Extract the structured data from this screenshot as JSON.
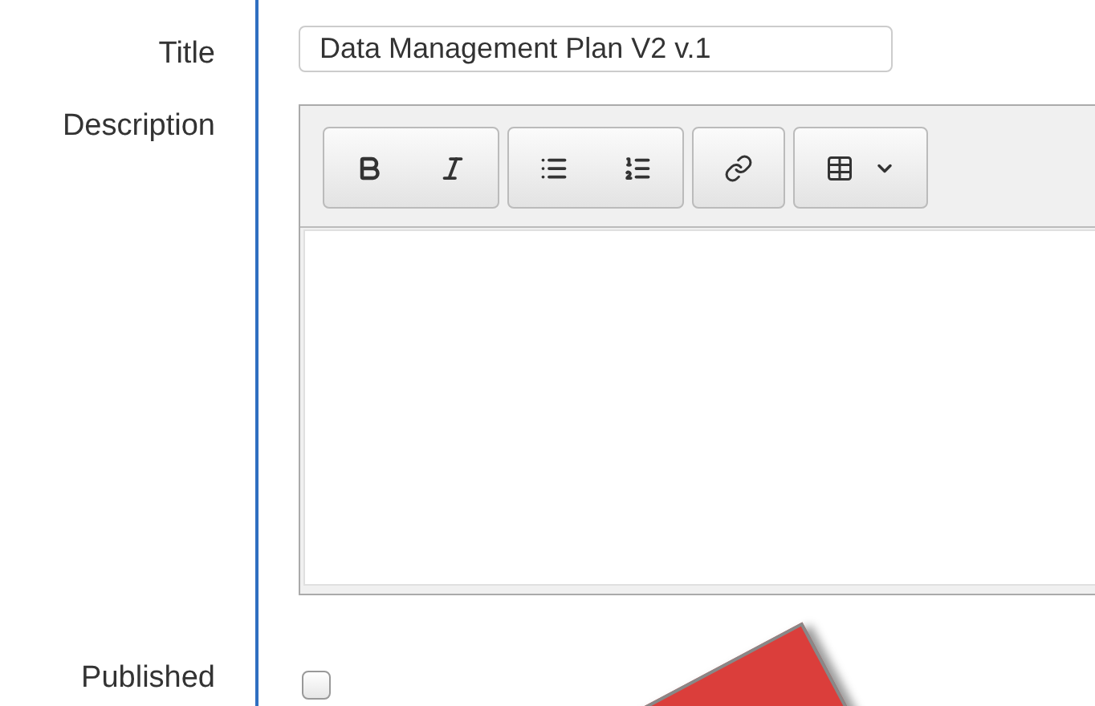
{
  "fields": [
    {
      "kind": "text",
      "label": "Title",
      "value": "Data Management Plan V2 v.1"
    },
    {
      "kind": "editor",
      "label": "Description"
    },
    {
      "kind": "checkbox",
      "label": "Published",
      "checked": false
    }
  ],
  "toolbar": [
    [
      {
        "kind": "bold"
      },
      {
        "kind": "italic"
      }
    ],
    [
      {
        "kind": "bullets"
      },
      {
        "kind": "numbers"
      }
    ],
    [
      {
        "kind": "link"
      }
    ],
    [
      {
        "kind": "table"
      }
    ]
  ]
}
